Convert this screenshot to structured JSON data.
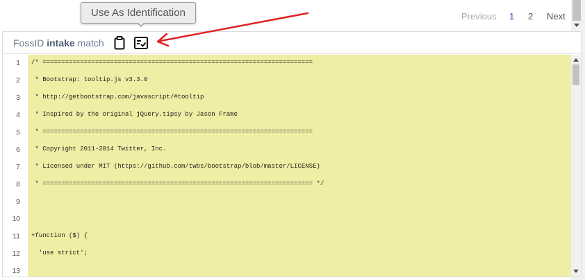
{
  "tooltip": {
    "text": "Use As Identification"
  },
  "pagination": {
    "previous": "Previous",
    "pages": [
      "1",
      "2"
    ],
    "current": "1",
    "next": "Next"
  },
  "panel": {
    "title_prefix": "FossID",
    "title_bold": "intake",
    "title_suffix": "match",
    "icons": [
      "clipboard-icon",
      "checklist-icon"
    ]
  },
  "colors": {
    "code_highlight": "#f0eda4",
    "annotation_arrow": "#e02020",
    "active_page": "#3f51b5"
  },
  "code": {
    "lines": [
      {
        "num": "1",
        "text": "/* ========================================================================"
      },
      {
        "num": "2",
        "text": " * Bootstrap: tooltip.js v3.3.0"
      },
      {
        "num": "3",
        "text": " * http://getbootstrap.com/javascript/#tooltip"
      },
      {
        "num": "4",
        "text": " * Inspired by the original jQuery.tipsy by Jason Frame"
      },
      {
        "num": "5",
        "text": " * ========================================================================"
      },
      {
        "num": "6",
        "text": " * Copyright 2011-2014 Twitter, Inc."
      },
      {
        "num": "7",
        "text": " * Licensed under MIT (https://github.com/twbs/bootstrap/blob/master/LICENSE)"
      },
      {
        "num": "8",
        "text": " * ======================================================================== */"
      },
      {
        "num": "9",
        "text": ""
      },
      {
        "num": "10",
        "text": ""
      },
      {
        "num": "11",
        "text": "+function ($) {"
      },
      {
        "num": "12",
        "text": "  'use strict';"
      },
      {
        "num": "13",
        "text": ""
      }
    ]
  }
}
